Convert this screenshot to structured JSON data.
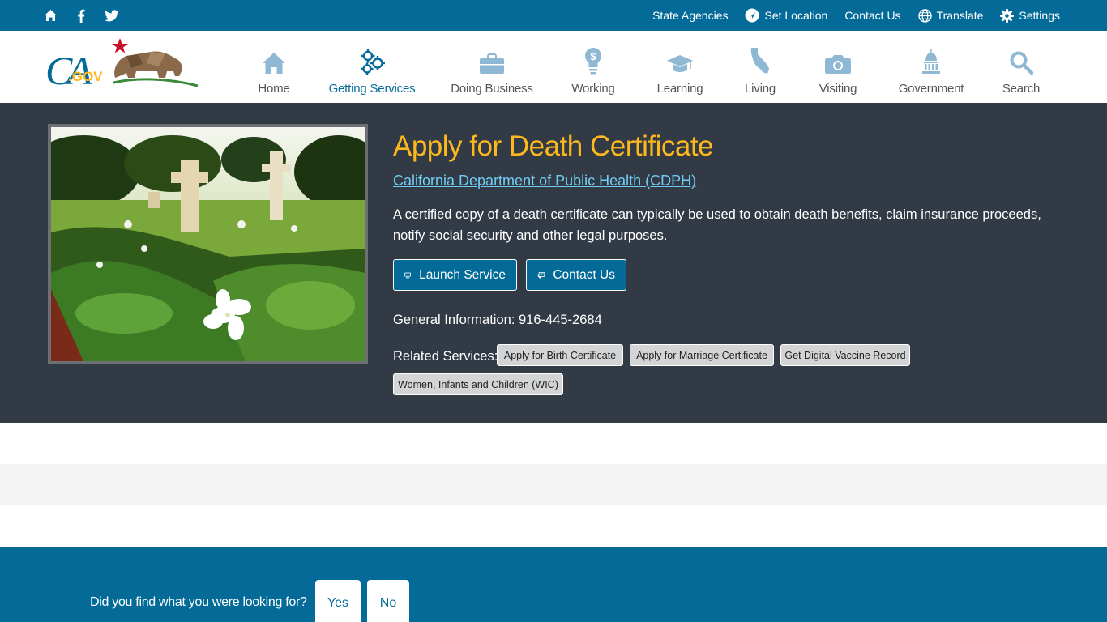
{
  "utility": {
    "links": [
      {
        "label": "State Agencies",
        "icon": "none"
      },
      {
        "label": "Set Location",
        "icon": "location-icon"
      },
      {
        "label": "Contact Us",
        "icon": "none"
      },
      {
        "label": "Translate",
        "icon": "globe-icon"
      },
      {
        "label": "Settings",
        "icon": "gear-icon"
      }
    ]
  },
  "nav": {
    "items": [
      {
        "label": "Home",
        "icon": "house-icon"
      },
      {
        "label": "Getting Services",
        "icon": "gears-icon",
        "active": true
      },
      {
        "label": "Doing Business",
        "icon": "briefcase-icon"
      },
      {
        "label": "Working",
        "icon": "lightbulb-dollar-icon"
      },
      {
        "label": "Learning",
        "icon": "graduation-cap-icon"
      },
      {
        "label": "Living",
        "icon": "california-state-icon"
      },
      {
        "label": "Visiting",
        "icon": "camera-icon"
      },
      {
        "label": "Government",
        "icon": "capitol-dome-icon"
      },
      {
        "label": "Search",
        "icon": "magnifier-icon"
      }
    ],
    "active_color": "#046b99"
  },
  "logo": {
    "text": "CA",
    "subtext": ".GOV"
  },
  "hero": {
    "title": "Apply for Death Certificate",
    "department": "California Department of Public Health (CDPH)",
    "description": "A certified copy of a death certificate can typically be used to obtain death benefits, claim insurance proceeds, notify social security and other legal purposes.",
    "launch_label": "Launch Service",
    "contact_label": "Contact Us",
    "info": "General Information: 916-445-2684",
    "related_label": "Related Services:",
    "related": [
      "Apply for Birth Certificate",
      "Apply for Marriage Certificate",
      "Get Digital Vaccine Record",
      "Women, Infants and Children (WIC)"
    ],
    "title_color": "#fdb81e",
    "background": "#323a45"
  },
  "feedback": {
    "question": "Did you find what you were looking for?",
    "yes": "Yes",
    "no": "No"
  }
}
